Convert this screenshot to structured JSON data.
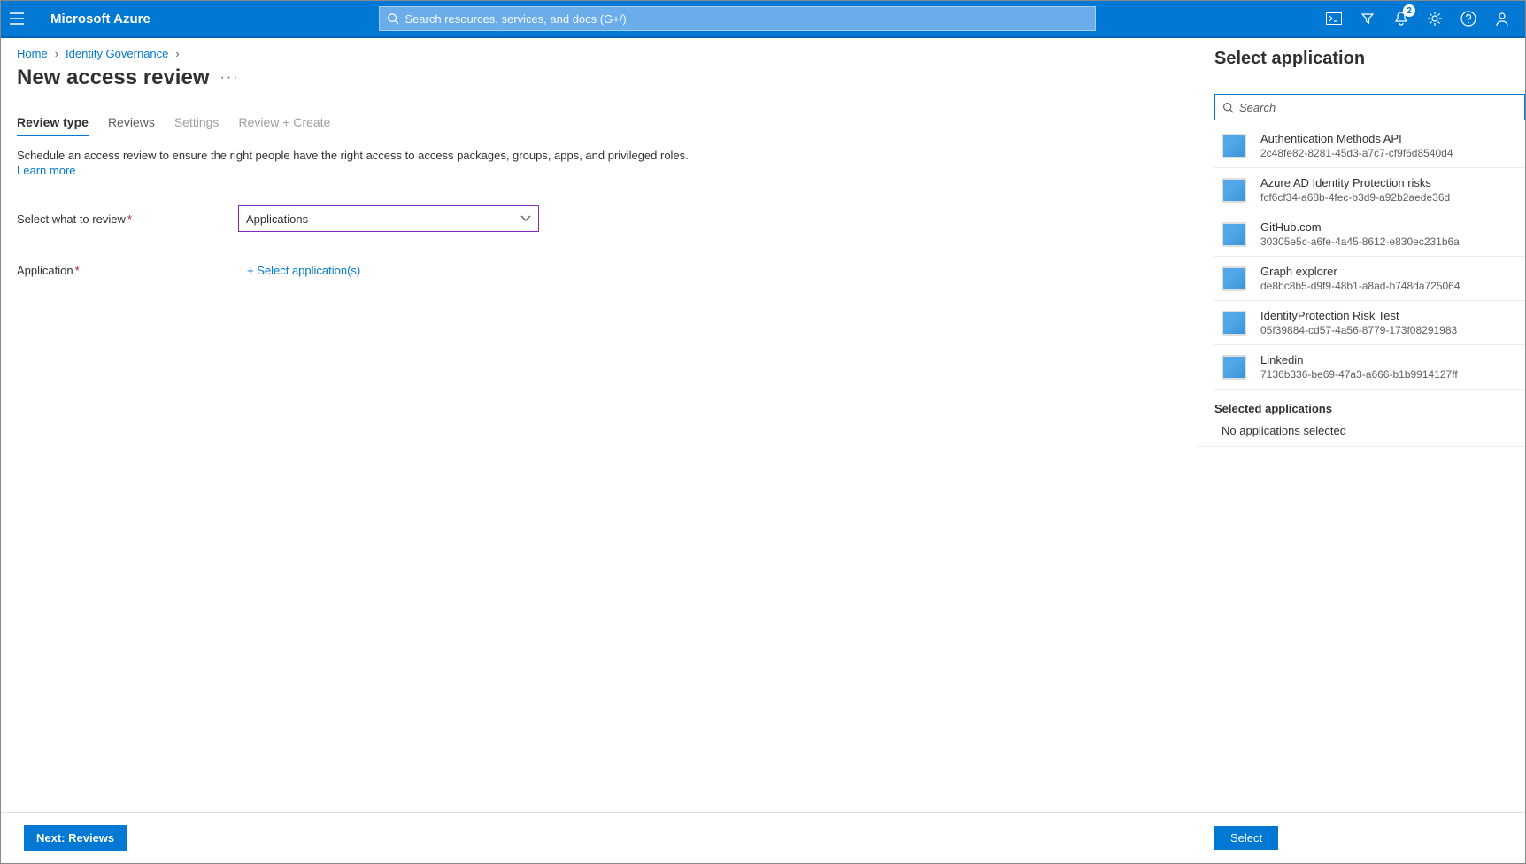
{
  "header": {
    "brand": "Microsoft Azure",
    "search_placeholder": "Search resources, services, and docs (G+/)",
    "notification_count": "2"
  },
  "breadcrumbs": [
    "Home",
    "Identity Governance"
  ],
  "page_title": "New access review",
  "tabs": [
    {
      "label": "Review type",
      "state": "active"
    },
    {
      "label": "Reviews",
      "state": "enabled"
    },
    {
      "label": "Settings",
      "state": "disabled"
    },
    {
      "label": "Review + Create",
      "state": "disabled"
    }
  ],
  "description": "Schedule an access review to ensure the right people have the right access to access packages, groups, apps, and privileged roles.",
  "learn_more_label": "Learn more",
  "form": {
    "select_what_label": "Select what to review",
    "select_what_value": "Applications",
    "application_label": "Application",
    "add_application_link": "+ Select application(s)"
  },
  "footer": {
    "next_label": "Next: Reviews"
  },
  "right_panel": {
    "title": "Select application",
    "search_placeholder": "Search",
    "applications": [
      {
        "name": "Authentication Methods API",
        "id": "2c48fe82-8281-45d3-a7c7-cf9f6d8540d4"
      },
      {
        "name": "Azure AD Identity Protection risks",
        "id": "fcf6cf34-a68b-4fec-b3d9-a92b2aede36d"
      },
      {
        "name": "GitHub.com",
        "id": "30305e5c-a6fe-4a45-8612-e830ec231b6a"
      },
      {
        "name": "Graph explorer",
        "id": "de8bc8b5-d9f9-48b1-a8ad-b748da725064"
      },
      {
        "name": "IdentityProtection Risk Test",
        "id": "05f39884-cd57-4a56-8779-173f08291983"
      },
      {
        "name": "Linkedin",
        "id": "7136b336-be69-47a3-a666-b1b9914127ff"
      }
    ],
    "selected_heading": "Selected applications",
    "no_selection_text": "No applications selected",
    "select_button": "Select"
  }
}
